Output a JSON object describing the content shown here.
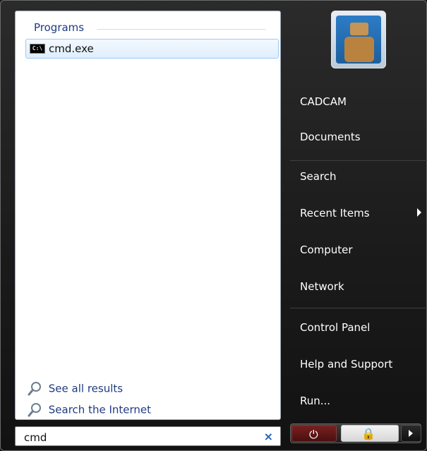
{
  "left_panel": {
    "group_title": "Programs",
    "programs": [
      {
        "icon": "cmd-icon",
        "icon_text": "C:\\",
        "label": "cmd.exe"
      }
    ],
    "links": [
      {
        "icon": "search-icon",
        "label": "See all results"
      },
      {
        "icon": "search-icon",
        "label": "Search the Internet"
      }
    ],
    "search": {
      "value": "cmd",
      "clear_icon": "close-icon",
      "clear_text": "×"
    }
  },
  "right_panel": {
    "avatar_alt": "user-avatar",
    "items": [
      {
        "label": "CADCAM"
      },
      {
        "label": "Documents"
      },
      {
        "label": "Search"
      },
      {
        "label": "Recent Items",
        "has_submenu": true
      },
      {
        "label": "Computer"
      },
      {
        "label": "Network"
      },
      {
        "label": "Control Panel"
      },
      {
        "label": "Help and Support"
      },
      {
        "label": "Run..."
      }
    ],
    "bottom_buttons": {
      "power_icon": "power-icon",
      "power_text": "⏻",
      "lock_icon": "lock-icon",
      "lock_text": "🔒",
      "more_icon": "chevron-right-icon"
    }
  },
  "colors": {
    "accent_blue": "#1f3b82",
    "power_red": "#7a2020"
  }
}
